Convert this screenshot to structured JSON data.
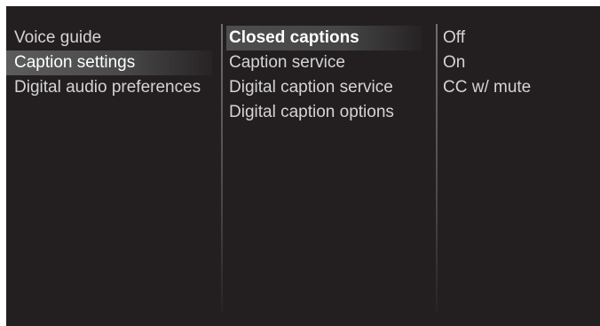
{
  "menu": {
    "level1": [
      {
        "label": "Voice guide",
        "state": "normal"
      },
      {
        "label": "Caption settings",
        "state": "selected"
      },
      {
        "label": "Digital audio preferences",
        "state": "normal"
      }
    ],
    "level2": [
      {
        "label": "Closed captions",
        "state": "focused"
      },
      {
        "label": "Caption service",
        "state": "normal"
      },
      {
        "label": "Digital caption service",
        "state": "normal"
      },
      {
        "label": "Digital caption options",
        "state": "normal"
      }
    ],
    "options": [
      {
        "label": "Off"
      },
      {
        "label": "On"
      },
      {
        "label": "CC w/ mute"
      }
    ]
  },
  "colors": {
    "background": "#231f20",
    "text": "#d4d4d4",
    "highlight": "#5c5c5c"
  }
}
